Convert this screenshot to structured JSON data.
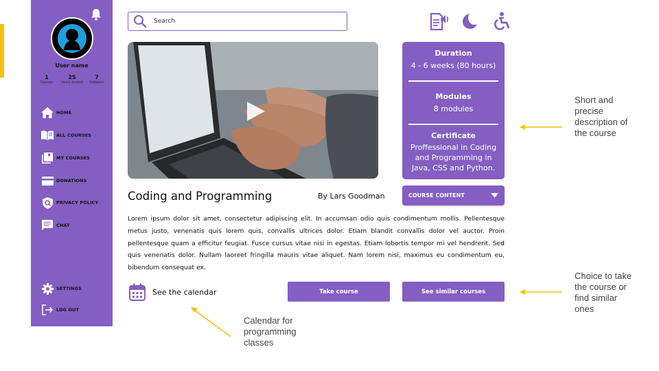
{
  "sidebar": {
    "username": "User name",
    "stats": [
      {
        "value": "1",
        "label": "Courses"
      },
      {
        "value": "25",
        "label": "Hours studied"
      },
      {
        "value": "7",
        "label": "Followers"
      }
    ],
    "nav": [
      {
        "label": "HOME",
        "icon": "home-icon"
      },
      {
        "label": "ALL COURSES",
        "icon": "book-open-icon"
      },
      {
        "label": "MY COURSES",
        "icon": "library-icon"
      },
      {
        "label": "DONATIONS",
        "icon": "card-icon"
      },
      {
        "label": "PRIVACY POLICY",
        "icon": "shield-icon"
      },
      {
        "label": "CHAT",
        "icon": "chat-icon"
      }
    ],
    "bottom_nav": [
      {
        "label": "SETTINGS",
        "icon": "gear-icon"
      },
      {
        "label": "LOG OUT",
        "icon": "logout-icon"
      }
    ]
  },
  "search": {
    "placeholder": "Search"
  },
  "toolbar_icons": [
    "text-to-speech-icon",
    "dark-mode-moon-icon",
    "accessibility-icon"
  ],
  "course": {
    "title": "Coding and Programming",
    "author": "By Lars Goodman",
    "description": "Lorem ipsum dolor sit amet, consectetur adipiscing elit. In accumsan odio quis condimentum mollis. Pellentesque metus justo, venenatis quis lorem quis, convallis ultrices dolor. Etiam blandit convallis dolor vel auctor. Proin pellentesque quam a efficitur feugiat. Fusce cursus vitae nisi in egestas. Etiam lobortis tempor mi vel hendrerit. Sed quis venenatis dolor. Nullam laoreet fringilla mauris vitae aliquet. Nam lorem nisi, maximus eu condimentum eu, bibendum consequat ex."
  },
  "info": {
    "duration_title": "Duration",
    "duration_value": "4 - 6 weeks (80 hours)",
    "modules_title": "Modules",
    "modules_value": "8 modules",
    "certificate_title": "Certificate",
    "certificate_lines": [
      "Proffessional in Coding",
      "and Programming in",
      "Java, CSS and Python."
    ]
  },
  "course_content_label": "COURSE CONTENT",
  "calendar_label": "See the calendar",
  "take_course_label": "Take course",
  "similar_label": "See similar courses",
  "annotations": {
    "info": [
      "Short and",
      "precise",
      "description of",
      "the course"
    ],
    "choice": [
      "Choice to take",
      "the course or",
      "find similar",
      "ones"
    ],
    "calendar": [
      "Calendar for",
      "programming",
      "classes"
    ]
  },
  "colors": {
    "brand": "#845ec2",
    "annotation_arrow": "#f4c20d"
  }
}
